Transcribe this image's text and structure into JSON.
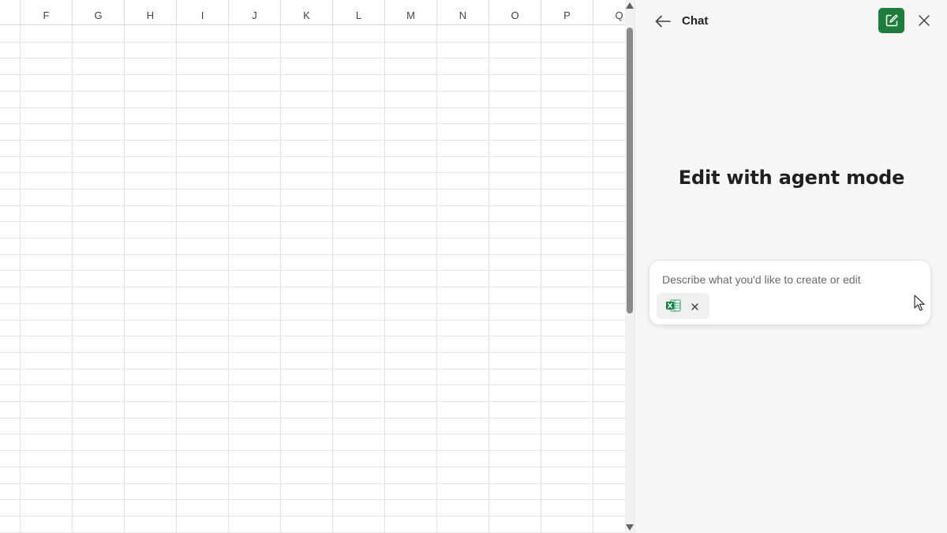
{
  "spreadsheet": {
    "columns": [
      "F",
      "G",
      "H",
      "I",
      "J",
      "K",
      "L",
      "M",
      "N",
      "O",
      "P",
      "Q"
    ]
  },
  "chat_pane": {
    "title": "Chat",
    "back_icon": "arrow-left-icon",
    "new_chat_icon": "compose-icon",
    "close_icon": "close-icon",
    "accent_color": "#1e7d3c",
    "heading": "Edit with agent mode",
    "composer": {
      "placeholder": "Describe what you'd like to create or edit",
      "value": "",
      "attachment_icon": "excel-file-icon",
      "attachment_remove_icon": "close-icon"
    }
  }
}
